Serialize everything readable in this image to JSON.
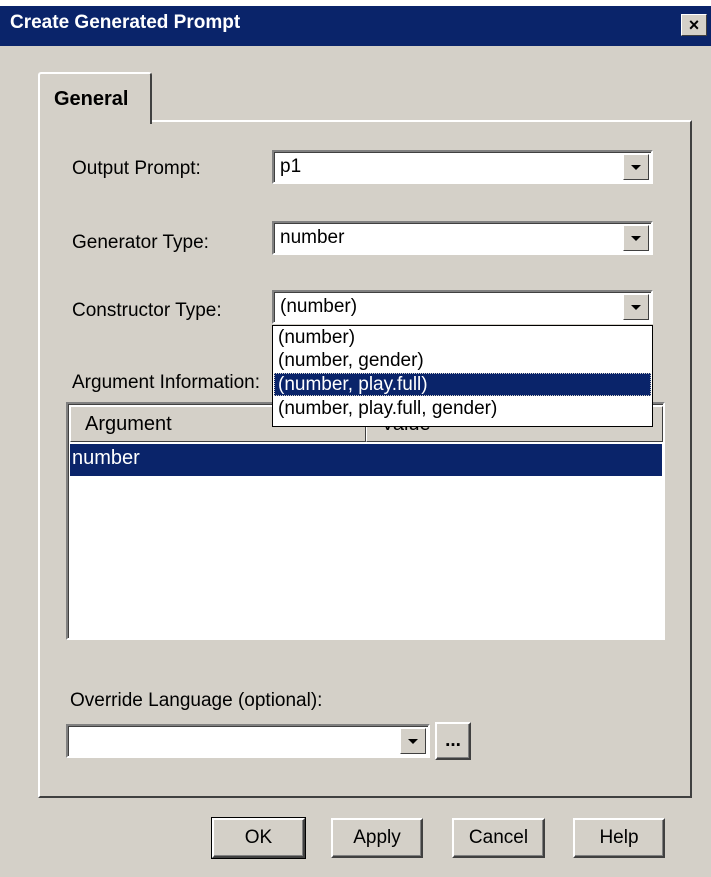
{
  "window": {
    "title": "Create Generated Prompt",
    "close_glyph": "×"
  },
  "tabs": [
    {
      "label": "General"
    }
  ],
  "form": {
    "output_prompt": {
      "label": "Output Prompt:",
      "value": "p1"
    },
    "generator_type": {
      "label": "Generator Type:",
      "value": "number"
    },
    "constructor_type": {
      "label": "Constructor Type:",
      "value": "(number)",
      "options": [
        "(number)",
        "(number, gender)",
        "(number, play.full)",
        "(number, play.full, gender)"
      ],
      "highlighted_index": 2
    },
    "argument_information": {
      "label": "Argument Information:",
      "columns": [
        "Argument",
        "Value"
      ],
      "rows": [
        {
          "argument": "number",
          "value": ""
        }
      ]
    },
    "override_language": {
      "label": "Override Language (optional):",
      "value": "",
      "browse_label": "..."
    }
  },
  "buttons": {
    "ok": "OK",
    "apply": "Apply",
    "cancel": "Cancel",
    "help": "Help"
  },
  "colors": {
    "titlebar": "#0a246a",
    "face": "#d4d0c8",
    "selection": "#0a246a"
  }
}
